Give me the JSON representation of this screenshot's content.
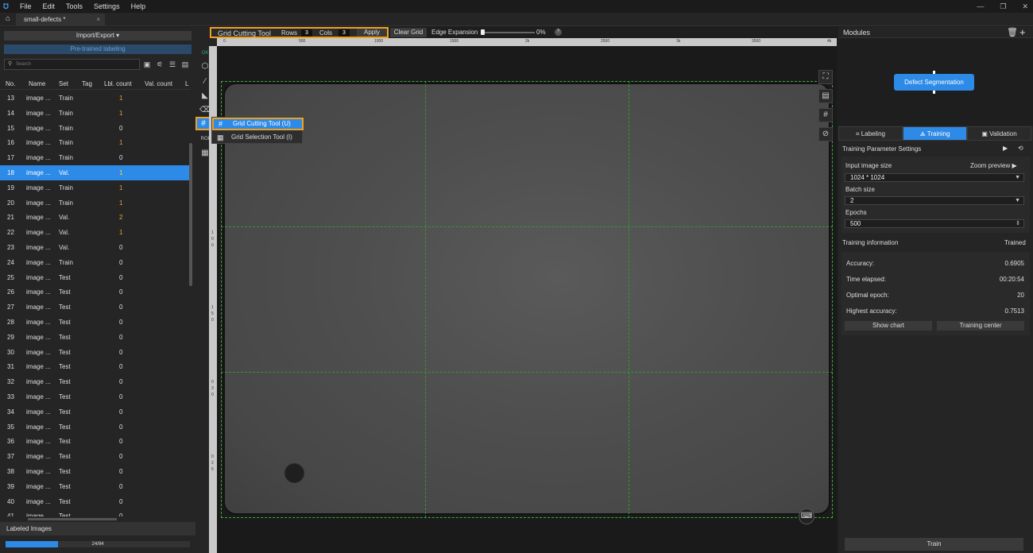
{
  "menu": {
    "file": "File",
    "edit": "Edit",
    "tools": "Tools",
    "settings": "Settings",
    "help": "Help"
  },
  "tab": {
    "title": "small-defects *",
    "close": "×"
  },
  "left": {
    "import_export": "Import/Export ▾",
    "pretrained": "Pre-trained labeling",
    "search_placeholder": "Search",
    "headers": {
      "no": "No.",
      "name": "Name",
      "set": "Set",
      "tag": "Tag",
      "lbl": "Lbl. count",
      "val": "Val. count",
      "extra": "L"
    },
    "rows": [
      {
        "no": "13",
        "name": "image ...",
        "set": "Train",
        "lbl": "1"
      },
      {
        "no": "14",
        "name": "image ...",
        "set": "Train",
        "lbl": "1"
      },
      {
        "no": "15",
        "name": "image ...",
        "set": "Train",
        "lbl": "0"
      },
      {
        "no": "16",
        "name": "image ...",
        "set": "Train",
        "lbl": "1"
      },
      {
        "no": "17",
        "name": "image ...",
        "set": "Train",
        "lbl": "0"
      },
      {
        "no": "18",
        "name": "image ...",
        "set": "Val.",
        "lbl": "1"
      },
      {
        "no": "19",
        "name": "image ...",
        "set": "Train",
        "lbl": "1"
      },
      {
        "no": "20",
        "name": "image ...",
        "set": "Train",
        "lbl": "1"
      },
      {
        "no": "21",
        "name": "image ...",
        "set": "Val.",
        "lbl": "2"
      },
      {
        "no": "22",
        "name": "image ...",
        "set": "Val.",
        "lbl": "1"
      },
      {
        "no": "23",
        "name": "image ...",
        "set": "Val.",
        "lbl": "0"
      },
      {
        "no": "24",
        "name": "image ...",
        "set": "Train",
        "lbl": "0"
      },
      {
        "no": "25",
        "name": "image ...",
        "set": "Test",
        "lbl": "0"
      },
      {
        "no": "26",
        "name": "image ...",
        "set": "Test",
        "lbl": "0"
      },
      {
        "no": "27",
        "name": "image ...",
        "set": "Test",
        "lbl": "0"
      },
      {
        "no": "28",
        "name": "image ...",
        "set": "Test",
        "lbl": "0"
      },
      {
        "no": "29",
        "name": "image ...",
        "set": "Test",
        "lbl": "0"
      },
      {
        "no": "30",
        "name": "image ...",
        "set": "Test",
        "lbl": "0"
      },
      {
        "no": "31",
        "name": "image ...",
        "set": "Test",
        "lbl": "0"
      },
      {
        "no": "32",
        "name": "image ...",
        "set": "Test",
        "lbl": "0"
      },
      {
        "no": "33",
        "name": "image ...",
        "set": "Test",
        "lbl": "0"
      },
      {
        "no": "34",
        "name": "image ...",
        "set": "Test",
        "lbl": "0"
      },
      {
        "no": "35",
        "name": "image ...",
        "set": "Test",
        "lbl": "0"
      },
      {
        "no": "36",
        "name": "image ...",
        "set": "Test",
        "lbl": "0"
      },
      {
        "no": "37",
        "name": "image ...",
        "set": "Test",
        "lbl": "0"
      },
      {
        "no": "38",
        "name": "image ...",
        "set": "Test",
        "lbl": "0"
      },
      {
        "no": "39",
        "name": "image ...",
        "set": "Test",
        "lbl": "0"
      },
      {
        "no": "40",
        "name": "image ...",
        "set": "Test",
        "lbl": "0"
      },
      {
        "no": "41",
        "name": "image ...",
        "set": "Test",
        "lbl": "0"
      }
    ],
    "selected_row": "18",
    "labeled_images": "Labeled Images",
    "progress_text": "24/84",
    "progress_value": 0.2857
  },
  "toolbar": {
    "grid_title": "Grid Cutting Tool",
    "rows_label": "Rows",
    "rows_value": "3",
    "cols_label": "Cols",
    "cols_value": "3",
    "apply": "Apply",
    "clear_grid": "Clear Grid",
    "edge_label": "Edge Expansion",
    "edge_value": "0%",
    "help": "?"
  },
  "ruler": {
    "top_ticks": [
      "0",
      "500",
      "1000",
      "1500",
      "2k",
      "2500",
      "3k",
      "3500",
      "4k"
    ],
    "left_ticks": [
      "1",
      "0",
      "0",
      "1",
      "5",
      "0",
      "0",
      "3",
      "0",
      "0",
      "2",
      "5"
    ]
  },
  "popup": {
    "item1": "Grid Cutting Tool (U)",
    "item2": "Grid Selection Tool (I)"
  },
  "right": {
    "modules": "Modules",
    "node": "Defect Segmentation",
    "tabs": {
      "labeling": "Labeling",
      "training": "Training",
      "validation": "Validation"
    },
    "params_title": "Training Parameter Settings",
    "input_size_label": "Input image size",
    "zoom_preview": "Zoom preview",
    "input_size": "1024 * 1024",
    "batch_label": "Batch size",
    "batch": "2",
    "epochs_label": "Epochs",
    "epochs": "500",
    "info_title": "Training information",
    "info_status": "Trained",
    "accuracy_label": "Accuracy:",
    "accuracy": "0.6905",
    "elapsed_label": "Time elapsed:",
    "elapsed": "00:20:54",
    "optimal_label": "Optimal epoch:",
    "optimal": "20",
    "highest_label": "Highest accuracy:",
    "highest": "0.7513",
    "show_chart": "Show chart",
    "training_center": "Training center",
    "train": "Train"
  },
  "colors": {
    "accent": "#2d8ae6",
    "highlight": "#f0a020",
    "grid": "#2f9a2f"
  }
}
